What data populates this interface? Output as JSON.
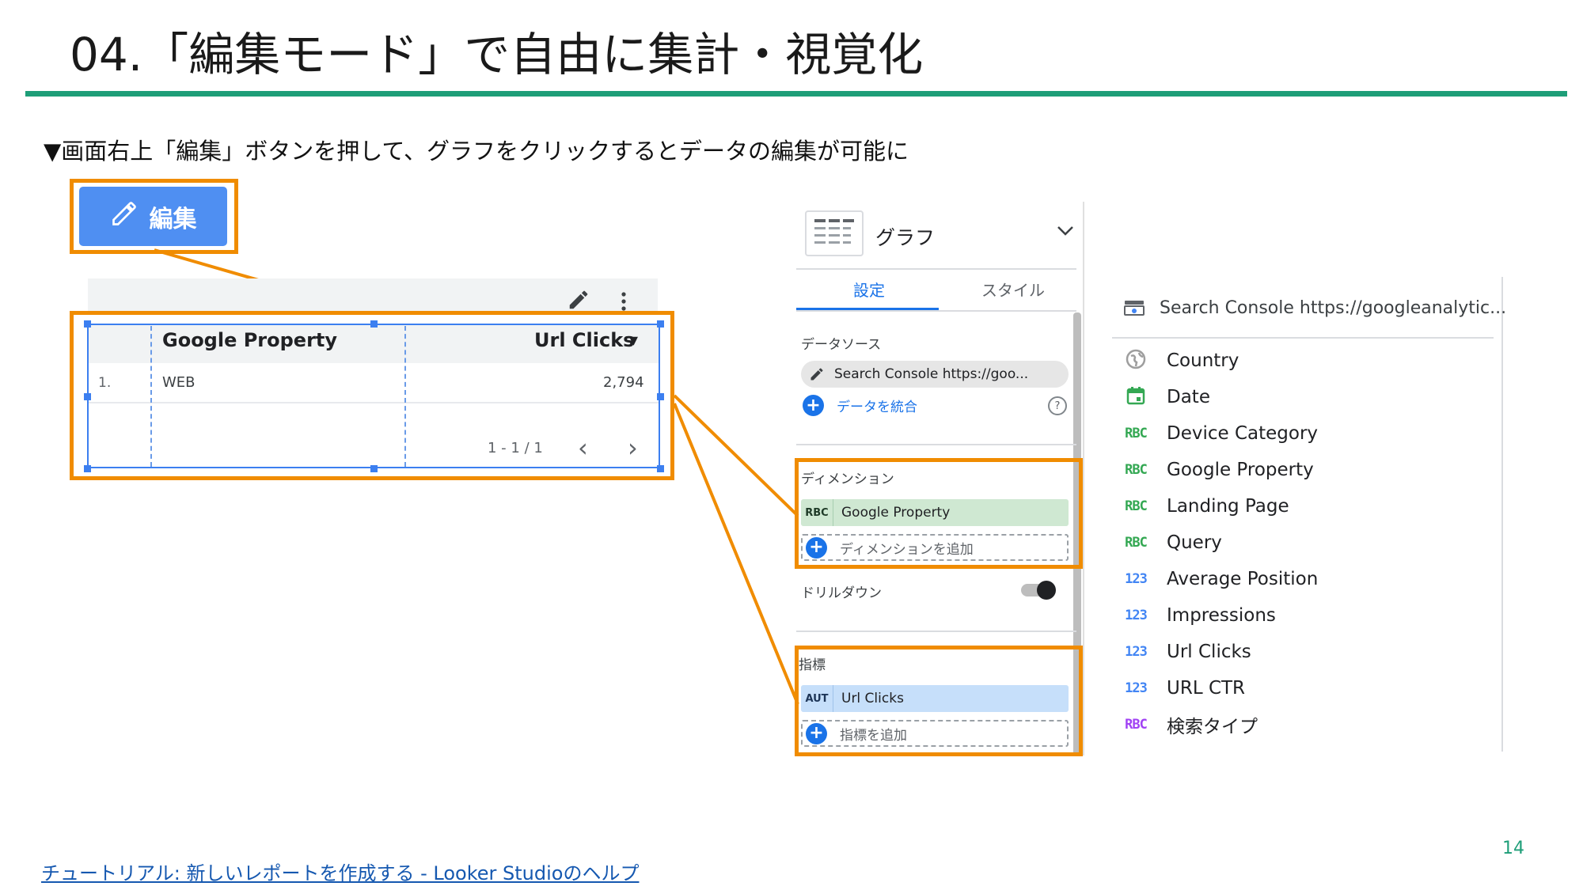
{
  "slide": {
    "title": "04.「編集モード」で自由に集計・視覚化",
    "subtitle": "▼画面右上「編集」ボタンを押して、グラフをクリックするとデータの編集が可能に",
    "page_number": "14",
    "footer_link": "チュートリアル: 新しいレポートを作成する - Looker Studioのヘルプ",
    "accent_color": "#1e9e78",
    "highlight_color": "#f08c00"
  },
  "edit_button": {
    "label": "編集",
    "icon": "pencil-icon",
    "color": "#4f8ff2"
  },
  "table": {
    "columns": [
      "Google Property",
      "Url Clicks"
    ],
    "sort_indicator": "▾",
    "rows": [
      {
        "index": "1.",
        "property": "WEB",
        "clicks": "2,794"
      }
    ],
    "pagination": "1 - 1 / 1",
    "prev": "‹",
    "next": "›"
  },
  "panel": {
    "chart_type": "グラフ",
    "tabs": [
      "設定",
      "スタイル"
    ],
    "active_tab": "設定",
    "data_source_label": "データソース",
    "data_source_value": "Search Console https://goo...",
    "blend_label": "データを統合",
    "dimension_label": "ディメンション",
    "dimension_type": "RBC",
    "dimension_value": "Google Property",
    "add_dimension": "ディメンションを追加",
    "drilldown_label": "ドリルダウン",
    "metric_label": "指標",
    "metric_type": "AUT",
    "metric_value": "Url Clicks",
    "add_metric": "指標を追加",
    "help_icon": "?",
    "dim_chip_color": "#cfe8d2",
    "metric_chip_color": "#c6dffa"
  },
  "field_list": {
    "source": "Search Console https://googleanalytic...",
    "fields": [
      {
        "type": "geo",
        "name": "Country",
        "color": "#9e9e9e"
      },
      {
        "type": "date",
        "name": "Date",
        "color": "#34a853"
      },
      {
        "type": "RBC",
        "name": "Device Category",
        "color": "#34a853"
      },
      {
        "type": "RBC",
        "name": "Google Property",
        "color": "#34a853"
      },
      {
        "type": "RBC",
        "name": "Landing Page",
        "color": "#34a853"
      },
      {
        "type": "RBC",
        "name": "Query",
        "color": "#34a853"
      },
      {
        "type": "123",
        "name": "Average Position",
        "color": "#4285f4"
      },
      {
        "type": "123",
        "name": "Impressions",
        "color": "#4285f4"
      },
      {
        "type": "123",
        "name": "Url Clicks",
        "color": "#4285f4"
      },
      {
        "type": "123",
        "name": "URL CTR",
        "color": "#4285f4"
      },
      {
        "type": "RBC",
        "name": "検索タイプ",
        "color": "#a142f4"
      }
    ]
  }
}
